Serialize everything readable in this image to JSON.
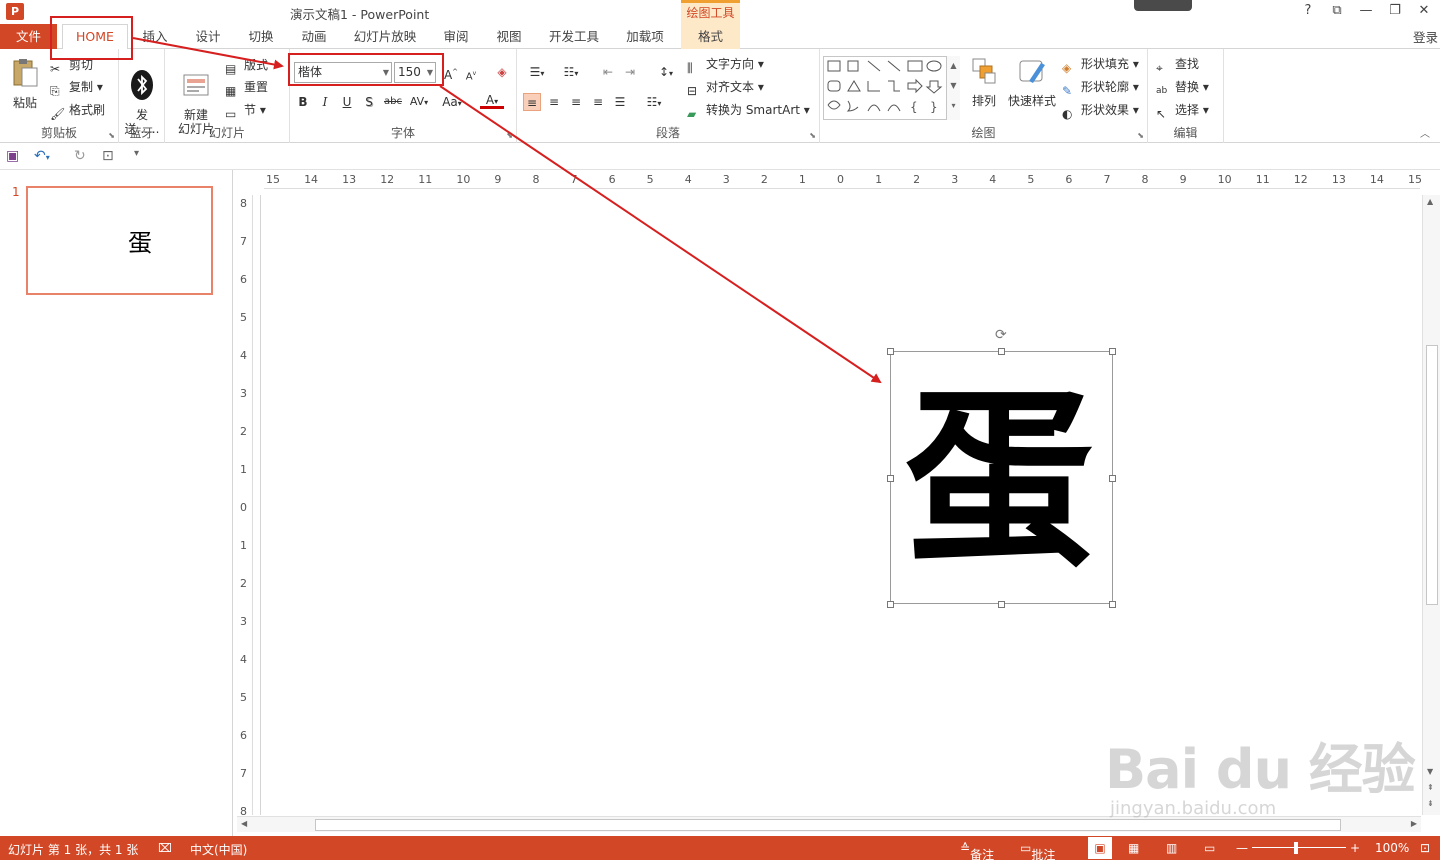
{
  "colors": {
    "accent": "#d24726",
    "annotation": "#d61f1f",
    "drawing_tools_bg": "#fde8c8"
  },
  "titlebar": {
    "app_icon": "P",
    "doc_title": "演示文稿1 - PowerPoint",
    "context_tab_label": "绘图工具",
    "help": "?",
    "ribbon_display": "⧉",
    "minimize": "—",
    "restore": "❐",
    "close": "✕"
  },
  "tabs": {
    "file": "文件",
    "home": "HOME",
    "items": [
      "插入",
      "设计",
      "切换",
      "动画",
      "幻灯片放映",
      "审阅",
      "视图",
      "开发工具",
      "加载项"
    ],
    "format": "格式",
    "login": "登录"
  },
  "ribbon": {
    "clipboard": {
      "label": "剪贴板",
      "paste": "粘贴",
      "cut": "剪切",
      "copy": "复制",
      "format_painter": "格式刷"
    },
    "bluetooth": {
      "label": "蓝牙",
      "send": "发\n送......"
    },
    "slides": {
      "label": "幻灯片",
      "new_slide": "新建\n幻灯片",
      "layout": "版式",
      "reset": "重置",
      "section": "节"
    },
    "font": {
      "label": "字体",
      "font_name": "楷体",
      "font_size": "150",
      "bold": "B",
      "italic": "I",
      "underline": "U",
      "shadow": "S",
      "strike": "abc",
      "spacing": "AV",
      "case": "Aa"
    },
    "paragraph": {
      "label": "段落",
      "text_direction": "文字方向",
      "align_text": "对齐文本",
      "smartart": "转换为 SmartArt"
    },
    "drawing": {
      "label": "绘图",
      "arrange": "排列",
      "quick_styles": "快速样式",
      "shape_fill": "形状填充",
      "shape_outline": "形状轮廓",
      "shape_effects": "形状效果"
    },
    "editing": {
      "label": "编辑",
      "find": "查找",
      "replace": "替换",
      "select": "选择"
    }
  },
  "thumbnail": {
    "number": "1",
    "text": "蛋"
  },
  "slide": {
    "text": "蛋"
  },
  "ruler": {
    "h": [
      "15",
      "14",
      "13",
      "12",
      "11",
      "10",
      "9",
      "8",
      "7",
      "6",
      "5",
      "4",
      "3",
      "2",
      "1",
      "0",
      "1",
      "2",
      "3",
      "4",
      "5",
      "6",
      "7",
      "8",
      "9",
      "10",
      "11",
      "12",
      "13",
      "14",
      "15"
    ],
    "v": [
      "8",
      "7",
      "6",
      "5",
      "4",
      "3",
      "2",
      "1",
      "0",
      "1",
      "2",
      "3",
      "4",
      "5",
      "6",
      "7",
      "8"
    ]
  },
  "statusbar": {
    "slide_info": "幻灯片 第 1 张，共 1 张",
    "language": "中文(中国)",
    "notes": "备注",
    "comments": "批注",
    "zoom": "100%"
  },
  "watermark": {
    "main": "Bai du 经验",
    "sub": "jingyan.baidu.com"
  }
}
